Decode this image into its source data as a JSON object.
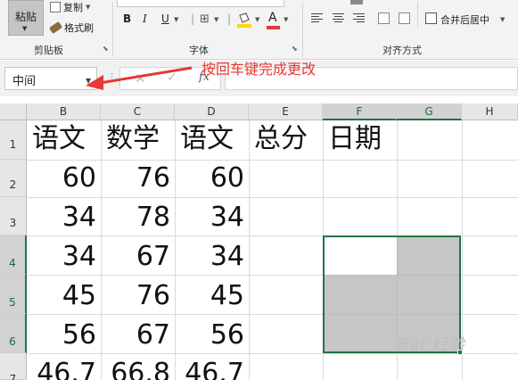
{
  "ribbon": {
    "paste_label": "粘贴",
    "copy_label": "复制",
    "format_painter_label": "格式刷",
    "clipboard_group": "剪贴板",
    "font_group": "字体",
    "alignment_group": "对齐方式",
    "bold": "B",
    "italic": "I",
    "underline": "U",
    "font_color_letter": "A",
    "merge_center_label": "合并后居中",
    "font_color": "#e53935",
    "fill_color": "#ffd700"
  },
  "formula_bar": {
    "name_box_value": "中间",
    "fx_label": "fx",
    "formula_value": ""
  },
  "annotation": {
    "text": "按回车键完成更改",
    "color": "#e53935"
  },
  "sheet": {
    "columns": [
      "B",
      "C",
      "D",
      "E",
      "F",
      "G",
      "H"
    ],
    "rows": [
      "1",
      "2",
      "3",
      "4",
      "5",
      "6",
      "7"
    ],
    "header_row": [
      "语文",
      "数学",
      "语文",
      "总分",
      "日期"
    ],
    "data": [
      [
        "60",
        "76",
        "60"
      ],
      [
        "34",
        "78",
        "34"
      ],
      [
        "34",
        "67",
        "34"
      ],
      [
        "45",
        "76",
        "45"
      ],
      [
        "56",
        "67",
        "56"
      ],
      [
        "46.7",
        "66.8",
        "46.7"
      ]
    ],
    "selection_range": "F4:G6",
    "accent_color": "#217346"
  },
  "watermark": {
    "text": "Bai 经验"
  }
}
